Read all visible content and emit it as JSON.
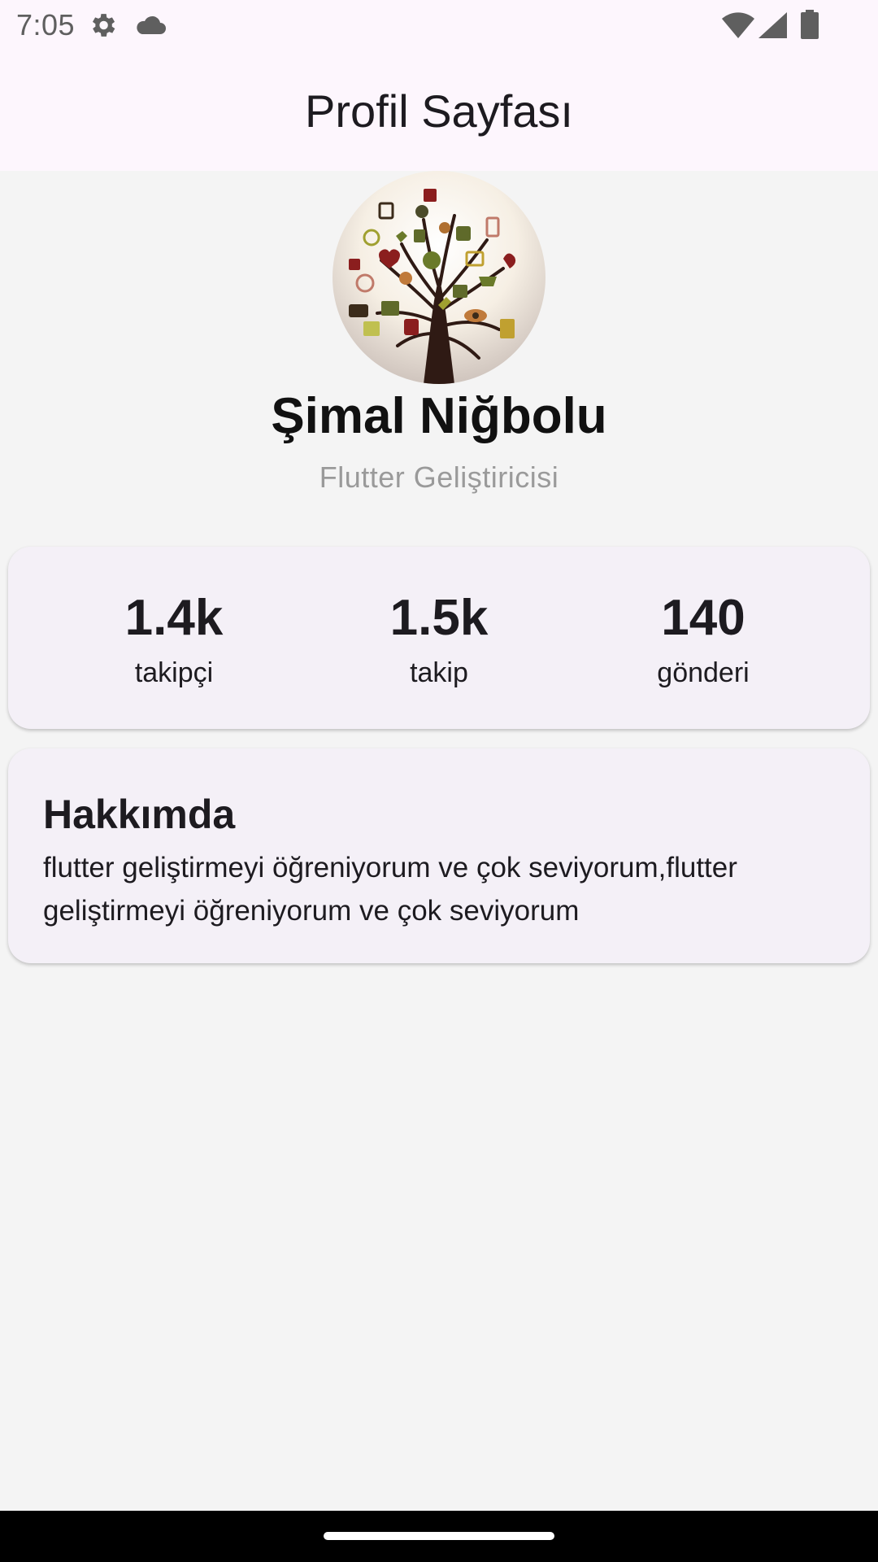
{
  "status_bar": {
    "time": "7:05",
    "icons": [
      "gear-icon",
      "cloud-icon",
      "wifi-icon",
      "signal-icon",
      "battery-icon"
    ]
  },
  "app_bar": {
    "title": "Profil Sayfası"
  },
  "profile": {
    "avatar": "social-tree-avatar",
    "name": "Şimal Niğbolu",
    "role": "Flutter Geliştiricisi"
  },
  "stats": [
    {
      "value": "1.4k",
      "label": "takipçi"
    },
    {
      "value": "1.5k",
      "label": "takip"
    },
    {
      "value": "140",
      "label": "gönderi"
    }
  ],
  "about": {
    "title": "Hakkımda",
    "text": "flutter geliştirmeyi öğreniyorum ve çok seviyorum,flutter geliştirmeyi öğreniyorum ve çok seviyorum"
  },
  "colors": {
    "app_bar_bg": "#fdf6fd",
    "page_bg": "#f4f4f4",
    "card_bg": "#f4f0f7",
    "text_primary": "#1d1b20",
    "text_secondary": "#9a9a9a"
  }
}
